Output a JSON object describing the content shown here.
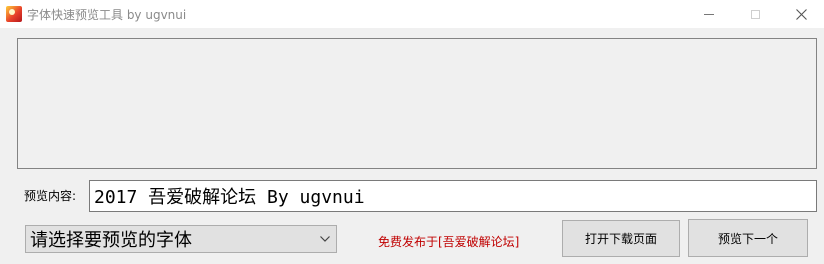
{
  "window": {
    "title": "字体快速预览工具 by ugvnui",
    "icon": "app-logo-icon",
    "controls": {
      "minimize": "minimize-icon",
      "maximize": "maximize-icon",
      "close": "close-icon"
    }
  },
  "preview": {
    "content_label": "预览内容:",
    "content_value": "2017 吾爱破解论坛 By ugvnui"
  },
  "font_select": {
    "placeholder": "请选择要预览的字体",
    "icon": "chevron-down-icon"
  },
  "footer": {
    "release_note": "免费发布于[吾爱破解论坛]",
    "open_download_label": "打开下载页面",
    "next_preview_label": "预览下一个"
  },
  "colors": {
    "release_note": "#c00000",
    "window_bg": "#f0f0f0",
    "button_bg": "#e1e1e1"
  }
}
